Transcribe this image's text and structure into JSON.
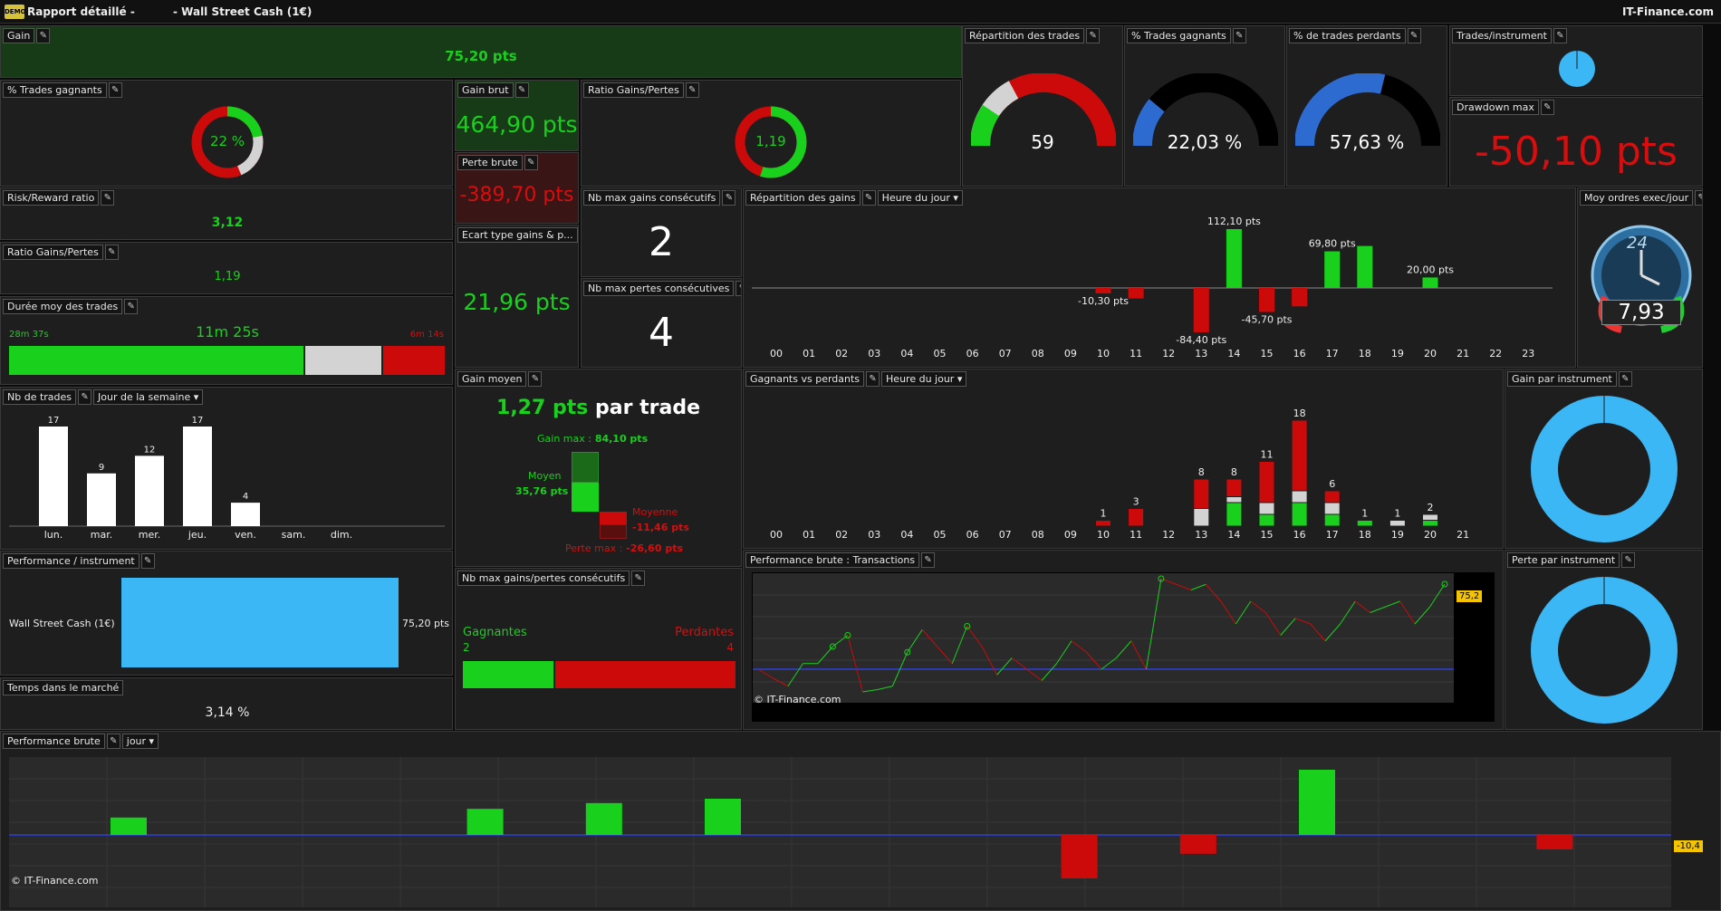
{
  "window": {
    "title": "Rapport détaillé -",
    "instrument": "- Wall Street Cash (1€)",
    "brand": "IT-Finance.com",
    "logo": "DEMO"
  },
  "icons": {
    "wrench": "wrench-icon",
    "dropdown": "chevron-down-icon"
  },
  "colors": {
    "green": "#19d11d",
    "red": "#cc0a0a",
    "blue": "#3cb7f5",
    "grey": "#d3d3d3",
    "bg": "#1e1e1e"
  },
  "gain": {
    "label": "Gain",
    "value": "75,20 pts"
  },
  "trades_gagnants_pct": {
    "label": "% Trades gagnants",
    "value": "22 %"
  },
  "gain_brut": {
    "label": "Gain brut",
    "value": "464,90 pts"
  },
  "perte_brute": {
    "label": "Perte brute",
    "value": "-389,70 pts"
  },
  "ratio_gp_ring": {
    "label": "Ratio Gains/Pertes",
    "value": "1,19"
  },
  "risk_reward": {
    "label": "Risk/Reward ratio",
    "value": "3,12"
  },
  "ratio_gp": {
    "label": "Ratio Gains/Pertes",
    "value": "1,19"
  },
  "duree": {
    "label": "Durée moy des trades",
    "avg": "11m 25s",
    "win": "28m 37s",
    "loss": "6m 14s"
  },
  "ecart_type": {
    "label": "Ecart type gains & p...",
    "value": "21,96 pts"
  },
  "nb_max_gains": {
    "label": "Nb max gains consécutifs",
    "value": "2"
  },
  "nb_max_pertes": {
    "label": "Nb max pertes consécutives",
    "value": "4"
  },
  "repartition_trades": {
    "label": "Répartition des trades",
    "value": "59"
  },
  "pct_gagnants_gauge": {
    "label": "% Trades gagnants",
    "value": "22,03 %",
    "fraction": 0.2203
  },
  "pct_perdants_gauge": {
    "label": "% de trades perdants",
    "value": "57,63 %",
    "fraction": 0.5763
  },
  "trades_instrument": {
    "label": "Trades/instrument"
  },
  "drawdown": {
    "label": "Drawdown max",
    "value": "-50,10 pts"
  },
  "moy_ordres": {
    "label": "Moy ordres exec/jour",
    "value": "7,93",
    "badge": "24"
  },
  "nb_trades": {
    "label": "Nb de trades",
    "dropdown": "Jour de la semaine",
    "chart_data": {
      "type": "bar",
      "categories": [
        "lun.",
        "mar.",
        "mer.",
        "jeu.",
        "ven.",
        "sam.",
        "dim."
      ],
      "values": [
        17,
        9,
        12,
        17,
        4,
        0,
        0
      ],
      "ylim": [
        0,
        17
      ]
    }
  },
  "gain_moyen": {
    "label": "Gain moyen",
    "value": "1,27 pts",
    "suffix": "par trade",
    "gain_max_label": "Gain max :",
    "gain_max": "84,10 pts",
    "moyen_label": "Moyen",
    "moyen": "35,76 pts",
    "moyenne_label": "Moyenne",
    "moyenne": "-11,46 pts",
    "perte_max_label": "Perte max :",
    "perte_max": "-26,60 pts"
  },
  "repartition_gains": {
    "label": "Répartition des gains",
    "dropdown": "Heure du jour",
    "chart_data": {
      "type": "bar",
      "categories": [
        "00",
        "01",
        "02",
        "03",
        "04",
        "05",
        "06",
        "07",
        "08",
        "09",
        "10",
        "11",
        "12",
        "13",
        "14",
        "15",
        "16",
        "17",
        "18",
        "19",
        "20",
        "21",
        "22",
        "23"
      ],
      "values": [
        0,
        0,
        0,
        0,
        0,
        0,
        0,
        0,
        0,
        0,
        -10.3,
        -20,
        0,
        -84.4,
        112.1,
        -45.7,
        -35,
        69.8,
        80,
        0,
        20,
        0,
        0,
        0
      ],
      "labels": {
        "10": "-10,30 pts",
        "13": "-84,40 pts",
        "14": "112,10 pts",
        "15": "-45,70 pts",
        "17": "69,80 pts",
        "20": "20,00 pts"
      }
    }
  },
  "gagnants_perdants": {
    "label": "Gagnants vs perdants",
    "dropdown": "Heure du jour",
    "chart_data": {
      "type": "bar",
      "categories": [
        "00",
        "01",
        "02",
        "03",
        "04",
        "05",
        "06",
        "07",
        "08",
        "09",
        "10",
        "11",
        "12",
        "13",
        "14",
        "15",
        "16",
        "17",
        "18",
        "19",
        "20",
        "21"
      ],
      "series": [
        {
          "name": "gagnants",
          "values": [
            0,
            0,
            0,
            0,
            0,
            0,
            0,
            0,
            0,
            0,
            0,
            0,
            0,
            0,
            4,
            2,
            4,
            2,
            1,
            0,
            1,
            0
          ]
        },
        {
          "name": "neutres",
          "values": [
            0,
            0,
            0,
            0,
            0,
            0,
            0,
            0,
            0,
            0,
            0,
            0,
            0,
            3,
            1,
            2,
            2,
            2,
            0,
            1,
            1,
            0
          ]
        },
        {
          "name": "perdants",
          "values": [
            0,
            0,
            0,
            0,
            0,
            0,
            0,
            0,
            0,
            0,
            1,
            3,
            0,
            5,
            3,
            7,
            12,
            2,
            0,
            0,
            0,
            0
          ]
        }
      ],
      "totals": [
        "",
        "",
        "",
        "",
        "",
        "",
        "",
        "",
        "",
        "",
        "1",
        "3",
        "",
        "8",
        "8",
        "11",
        "18",
        "6",
        "1",
        "1",
        "2",
        ""
      ]
    }
  },
  "gain_instrument": {
    "label": "Gain par instrument"
  },
  "perte_instrument": {
    "label": "Perte par instrument"
  },
  "perf_instrument": {
    "label": "Performance / instrument",
    "instrument": "Wall Street Cash (1€)",
    "value": "75,20 pts"
  },
  "temps_marche": {
    "label": "Temps dans le marché",
    "value": "3,14 %"
  },
  "nb_max_gp": {
    "label": "Nb max gains/pertes consécutifs",
    "gagnantes": "Gagnantes",
    "perdantes": "Perdantes",
    "g_val": "2",
    "p_val": "4",
    "g_fraction": 0.333
  },
  "perf_transactions": {
    "label": "Performance brute : Transactions",
    "watermark": "© IT-Finance.com",
    "last": "75,2",
    "chart_data": {
      "type": "line",
      "values": [
        0,
        -8,
        -15,
        5,
        5,
        20,
        30,
        -20,
        -18,
        -15,
        15,
        35,
        20,
        5,
        38,
        20,
        -5,
        10,
        0,
        -10,
        5,
        25,
        15,
        0,
        10,
        25,
        0,
        80,
        75,
        70,
        75,
        60,
        40,
        60,
        50,
        30,
        45,
        40,
        25,
        40,
        60,
        50,
        55,
        60,
        40,
        55,
        75.2
      ]
    }
  },
  "perf_brute": {
    "label": "Performance brute",
    "dropdown": "jour",
    "watermark": "© IT-Finance.com",
    "last": "-10,4",
    "chart_data": {
      "type": "bar",
      "values": [
        12,
        0,
        0,
        18,
        22,
        25,
        0,
        0,
        -30,
        -13,
        45,
        0,
        -10,
        0
      ]
    }
  }
}
